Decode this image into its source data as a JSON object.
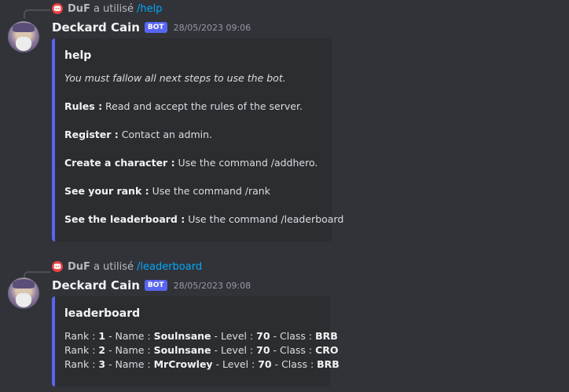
{
  "messages": [
    {
      "reply": {
        "user": "DuF",
        "text": "a utilisé",
        "command": "/help"
      },
      "author": "Deckard Cain",
      "bot_tag": "BOT",
      "timestamp": "28/05/2023 09:06",
      "embed": {
        "title": "help",
        "intro": "You must fallow all next steps to use the bot.",
        "steps": [
          {
            "label": "Rules :",
            "text": " Read and accept the rules of the server."
          },
          {
            "label": "Register :",
            "text": " Contact an admin."
          },
          {
            "label": "Create a character :",
            "text": " Use the command /addhero."
          },
          {
            "label": "See your rank :",
            "text": " Use the command /rank"
          },
          {
            "label": "See the leaderboard :",
            "text": " Use the command /leaderboard"
          }
        ]
      }
    },
    {
      "reply": {
        "user": "DuF",
        "text": "a utilisé",
        "command": "/leaderboard"
      },
      "author": "Deckard Cain",
      "bot_tag": "BOT",
      "timestamp": "28/05/2023 09:08",
      "embed": {
        "title": "leaderboard",
        "labels": {
          "rank": "Rank : ",
          "name": " - Name : ",
          "level": " - Level : ",
          "class": " - Class : "
        },
        "rows": [
          {
            "rank": "1",
            "name": "Soulnsane",
            "level": "70",
            "class": "BRB"
          },
          {
            "rank": "2",
            "name": "Soulnsane",
            "level": "70",
            "class": "CRO"
          },
          {
            "rank": "3",
            "name": "MrCrowley",
            "level": "70",
            "class": "BRB"
          }
        ]
      }
    }
  ],
  "colors": {
    "accent": "#5865f2",
    "background": "#313338",
    "embed_bg": "#2b2d31",
    "command_link": "#00a8fc"
  }
}
